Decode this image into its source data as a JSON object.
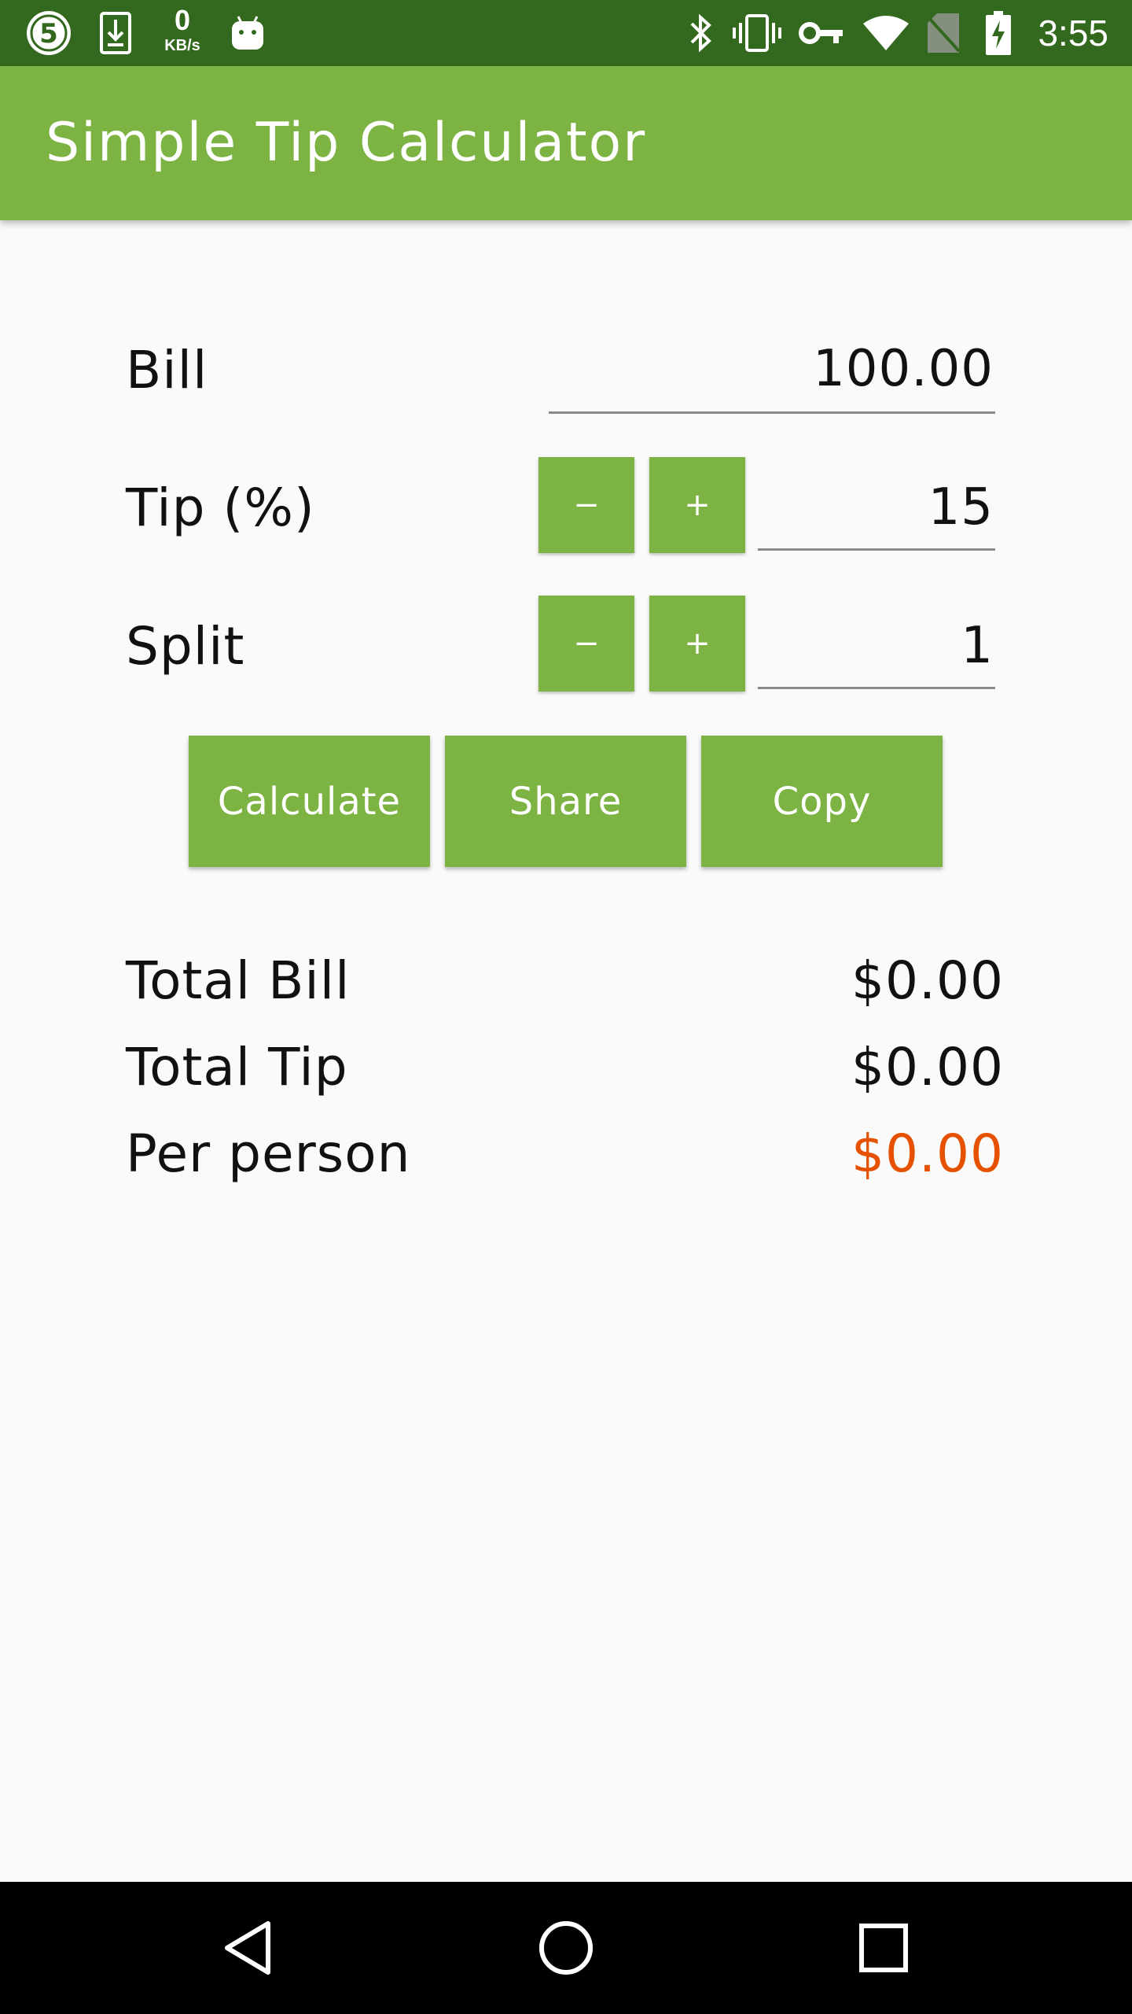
{
  "status_bar": {
    "time": "3:55",
    "net_speed_value": "0",
    "net_speed_unit": "KB/s",
    "icons": [
      "app-5-icon",
      "download-icon",
      "android-icon",
      "bluetooth-icon",
      "vibrate-icon",
      "vpn-key-icon",
      "wifi-icon",
      "no-sim-icon",
      "battery-charging-icon"
    ]
  },
  "app_bar": {
    "title": "Simple Tip Calculator"
  },
  "form": {
    "bill": {
      "label": "Bill",
      "value": "100.00"
    },
    "tip": {
      "label": "Tip (%)",
      "value": "15",
      "minus": "−",
      "plus": "+"
    },
    "split": {
      "label": "Split",
      "value": "1",
      "minus": "−",
      "plus": "+"
    }
  },
  "actions": {
    "calculate": "Calculate",
    "share": "Share",
    "copy": "Copy"
  },
  "results": {
    "total_bill": {
      "label": "Total Bill",
      "value": "$0.00"
    },
    "total_tip": {
      "label": "Total Tip",
      "value": "$0.00"
    },
    "per_person": {
      "label": "Per person",
      "value": "$0.00"
    }
  },
  "colors": {
    "status_bar": "#33691e",
    "primary": "#7cb342",
    "accent": "#e65100",
    "background": "#fafafa"
  },
  "nav_bar": {
    "icons": [
      "back-icon",
      "home-icon",
      "recents-icon"
    ]
  }
}
